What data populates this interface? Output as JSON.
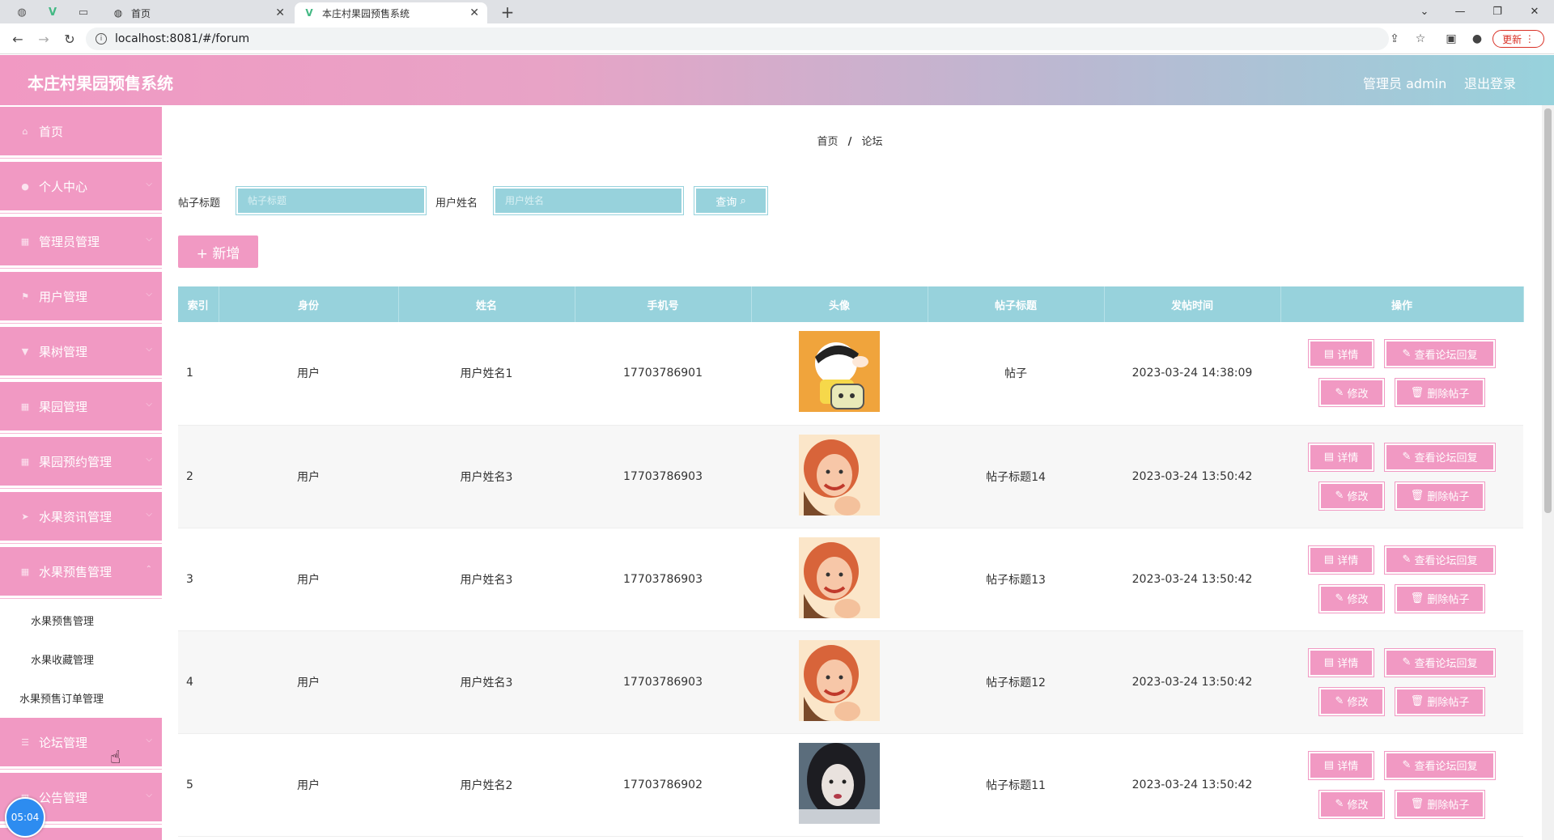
{
  "browser": {
    "tabs": [
      {
        "title": "首页",
        "active": false
      },
      {
        "title": "本庄村果园预售系统",
        "active": true
      }
    ],
    "url": "localhost:8081/#/forum",
    "update_label": "更新"
  },
  "header": {
    "title": "本庄村果园预售系统",
    "user_label": "管理员 admin",
    "logout_label": "退出登录"
  },
  "sidebar": {
    "items": [
      {
        "label": "首页",
        "icon": "home-icon"
      },
      {
        "label": "个人中心",
        "icon": "user-icon"
      },
      {
        "label": "管理员管理",
        "icon": "grid-icon"
      },
      {
        "label": "用户管理",
        "icon": "flag-icon"
      },
      {
        "label": "果树管理",
        "icon": "filter-icon"
      },
      {
        "label": "果园管理",
        "icon": "grid-icon"
      },
      {
        "label": "果园预约管理",
        "icon": "grid-icon"
      },
      {
        "label": "水果资讯管理",
        "icon": "send-icon"
      },
      {
        "label": "水果预售管理",
        "icon": "grid-icon"
      }
    ],
    "submenu": [
      "水果预售管理",
      "水果收藏管理",
      "水果预售订单管理"
    ],
    "items_bottom": [
      {
        "label": "论坛管理",
        "icon": "list-icon"
      },
      {
        "label": "公告管理",
        "icon": "grid-icon"
      }
    ],
    "timer": "05:04"
  },
  "breadcrumb": {
    "home": "首页",
    "separator": "/",
    "current": "论坛"
  },
  "search": {
    "title_label": "帖子标题",
    "title_placeholder": "帖子标题",
    "name_label": "用户姓名",
    "name_placeholder": "用户姓名",
    "query_label": "查询"
  },
  "add_label": "+ 新增",
  "table": {
    "columns": [
      "索引",
      "身份",
      "姓名",
      "手机号",
      "头像",
      "帖子标题",
      "发帖时间",
      "操作"
    ],
    "rows": [
      {
        "index": "1",
        "role": "用户",
        "name": "用户姓名1",
        "phone": "17703786901",
        "avatar": "cartoon",
        "title": "帖子",
        "time": "2023-03-24 14:38:09"
      },
      {
        "index": "2",
        "role": "用户",
        "name": "用户姓名3",
        "phone": "17703786903",
        "avatar": "girl-smile",
        "title": "帖子标题14",
        "time": "2023-03-24 13:50:42"
      },
      {
        "index": "3",
        "role": "用户",
        "name": "用户姓名3",
        "phone": "17703786903",
        "avatar": "girl-smile",
        "title": "帖子标题13",
        "time": "2023-03-24 13:50:42"
      },
      {
        "index": "4",
        "role": "用户",
        "name": "用户姓名3",
        "phone": "17703786903",
        "avatar": "girl-smile",
        "title": "帖子标题12",
        "time": "2023-03-24 13:50:42"
      },
      {
        "index": "5",
        "role": "用户",
        "name": "用户姓名2",
        "phone": "17703786902",
        "avatar": "girl-dark",
        "title": "帖子标题11",
        "time": "2023-03-24 13:50:42"
      }
    ],
    "actions": {
      "detail": "详情",
      "view_replies": "查看论坛回复",
      "edit": "修改",
      "delete": "删除帖子"
    }
  },
  "colors": {
    "pink": "#f199c3",
    "teal": "#97d2dc"
  }
}
